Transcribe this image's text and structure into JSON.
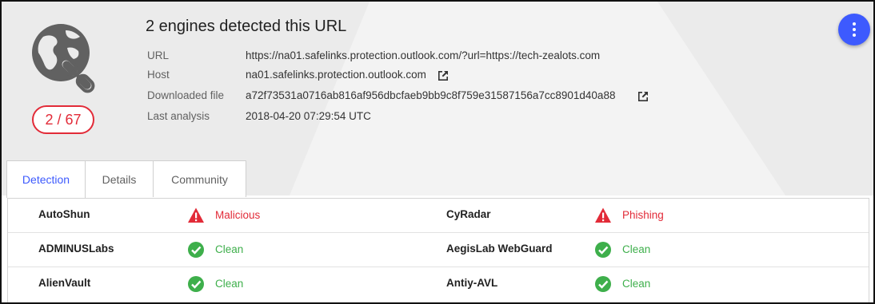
{
  "header": {
    "title": "2 engines detected this URL",
    "detection_ratio": "2 / 67",
    "icon": "globe-link-icon",
    "fields": [
      {
        "label": "URL",
        "value": "https://na01.safelinks.protection.outlook.com/?url=https://tech-zealots.com",
        "link_icon": false
      },
      {
        "label": "Host",
        "value": "na01.safelinks.protection.outlook.com",
        "link_icon": true
      },
      {
        "label": "Downloaded file",
        "value": "a72f73531a0716ab816af956dbcfaeb9bb9c8f759e31587156a7cc8901d40a88",
        "link_icon": true
      },
      {
        "label": "Last analysis",
        "value": "2018-04-20 07:29:54 UTC",
        "link_icon": false
      }
    ]
  },
  "menu_button": {
    "icon": "more-vert-icon",
    "color": "#3d5afe"
  },
  "tabs": [
    {
      "label": "Detection",
      "active": true
    },
    {
      "label": "Details",
      "active": false
    },
    {
      "label": "Community",
      "active": false
    }
  ],
  "results": [
    {
      "left": {
        "engine": "AutoShun",
        "status": "Malicious",
        "icon": "warning-icon"
      },
      "right": {
        "engine": "CyRadar",
        "status": "Phishing",
        "icon": "warning-icon"
      }
    },
    {
      "left": {
        "engine": "ADMINUSLabs",
        "status": "Clean",
        "icon": "check-circle-icon"
      },
      "right": {
        "engine": "AegisLab WebGuard",
        "status": "Clean",
        "icon": "check-circle-icon"
      }
    },
    {
      "left": {
        "engine": "AlienVault",
        "status": "Clean",
        "icon": "check-circle-icon"
      },
      "right": {
        "engine": "Antiy-AVL",
        "status": "Clean",
        "icon": "check-circle-icon"
      }
    }
  ],
  "colors": {
    "malicious": "#e22b38",
    "clean": "#3eaf4b",
    "accent": "#3d5afe",
    "header_bg": "#ebebeb"
  }
}
